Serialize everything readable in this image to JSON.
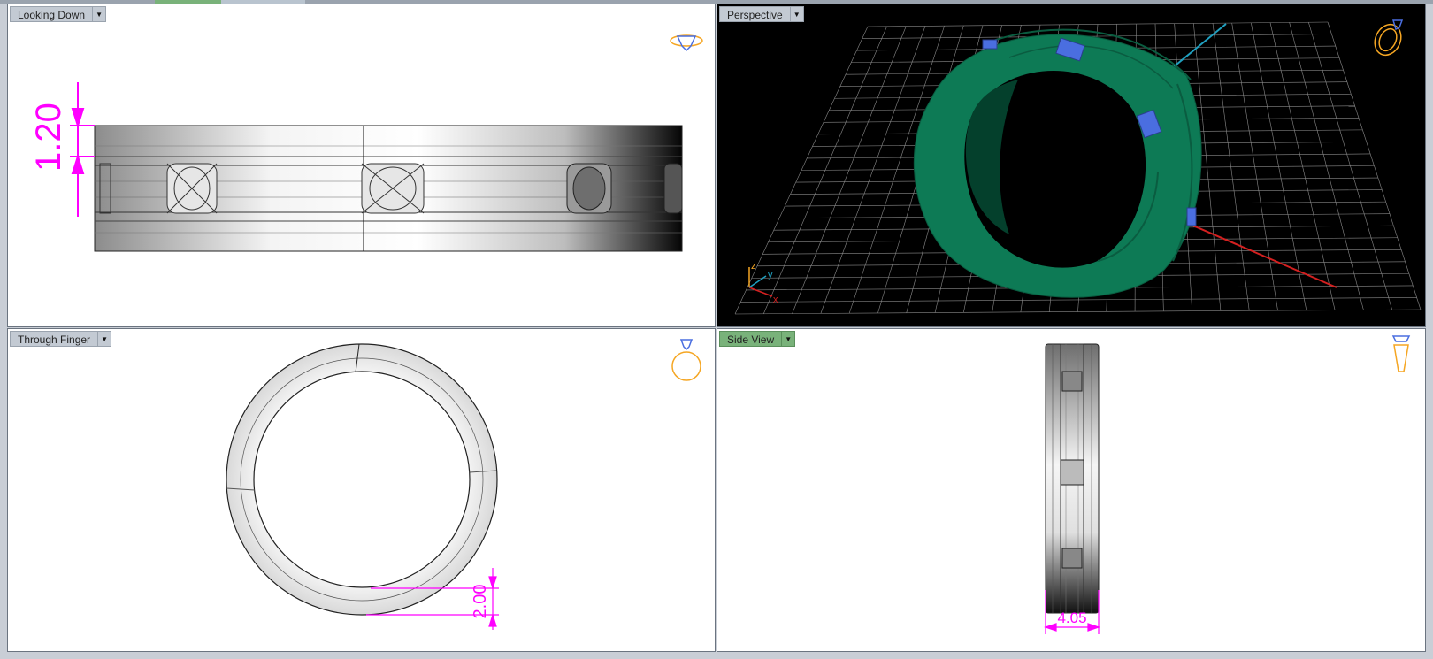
{
  "colors": {
    "dimension": "#ff00ff",
    "ring_green": "#0d7a55",
    "grid": "#8a8a8a",
    "axis_red": "#d42020",
    "axis_cyan": "#20a0c0",
    "icon_orange": "#f5a623",
    "stone_blue": "#4a6ee0"
  },
  "viewports": {
    "top_left": {
      "label": "Looking Down",
      "dimension": "1.20"
    },
    "top_right": {
      "label": "Perspective",
      "axis_z": "z",
      "axis_y": "y",
      "axis_x": "x"
    },
    "bottom_left": {
      "label": "Through Finger",
      "dimension": "2.00"
    },
    "bottom_right": {
      "label": "Side View",
      "dimension": "4.05",
      "active": true
    }
  }
}
